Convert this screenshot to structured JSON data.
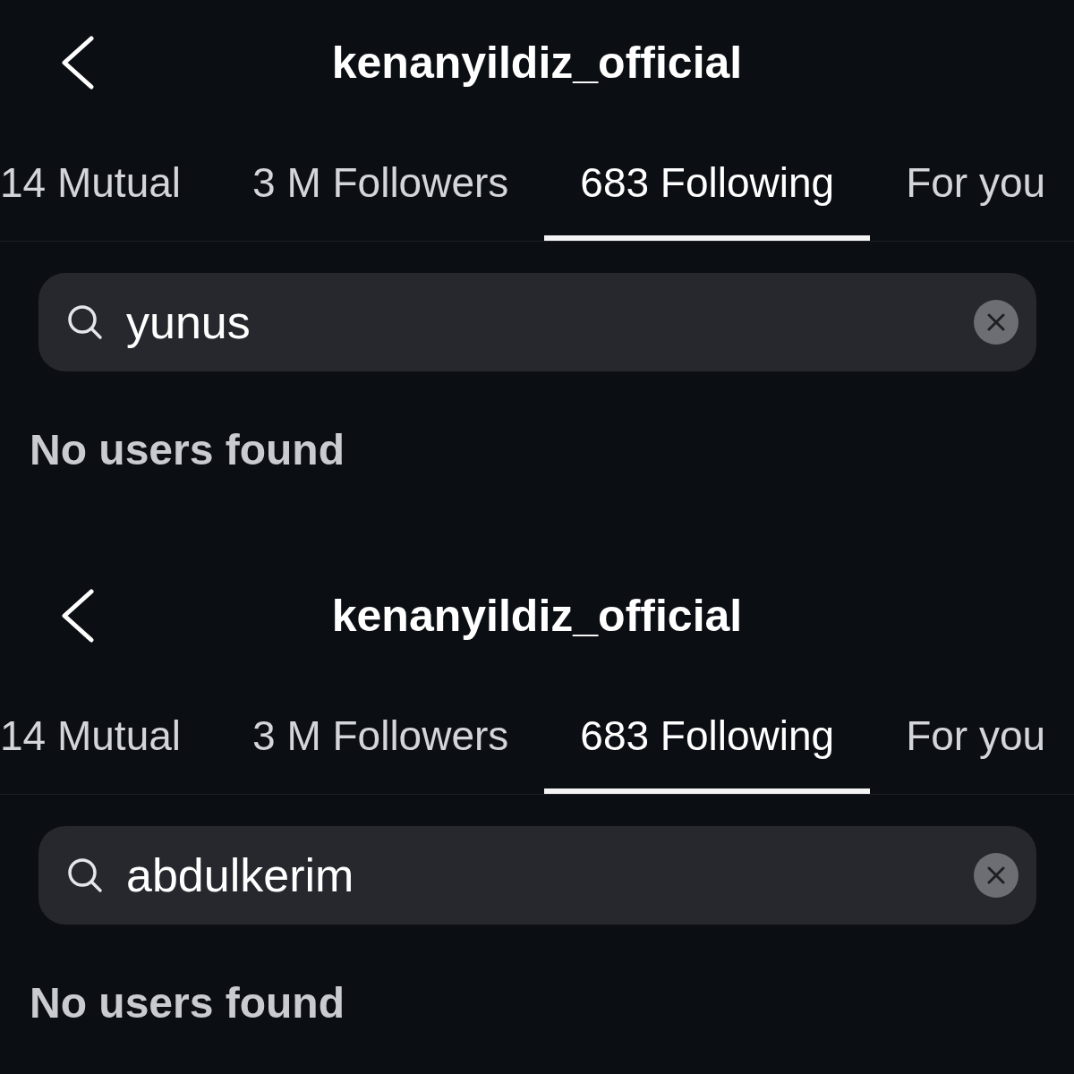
{
  "screens": [
    {
      "header": {
        "title": "kenanyildiz_official"
      },
      "tabs": [
        {
          "label": "14 Mutual",
          "selected": false
        },
        {
          "label": "3 M Followers",
          "selected": false
        },
        {
          "label": "683 Following",
          "selected": true
        },
        {
          "label": "For you",
          "selected": false
        }
      ],
      "search": {
        "value": "yunus"
      },
      "empty_message": "No users found"
    },
    {
      "header": {
        "title": "kenanyildiz_official"
      },
      "tabs": [
        {
          "label": "14 Mutual",
          "selected": false
        },
        {
          "label": "3 M Followers",
          "selected": false
        },
        {
          "label": "683 Following",
          "selected": true
        },
        {
          "label": "For you",
          "selected": false
        }
      ],
      "search": {
        "value": "abdulkerim"
      },
      "empty_message": "No users found"
    }
  ]
}
